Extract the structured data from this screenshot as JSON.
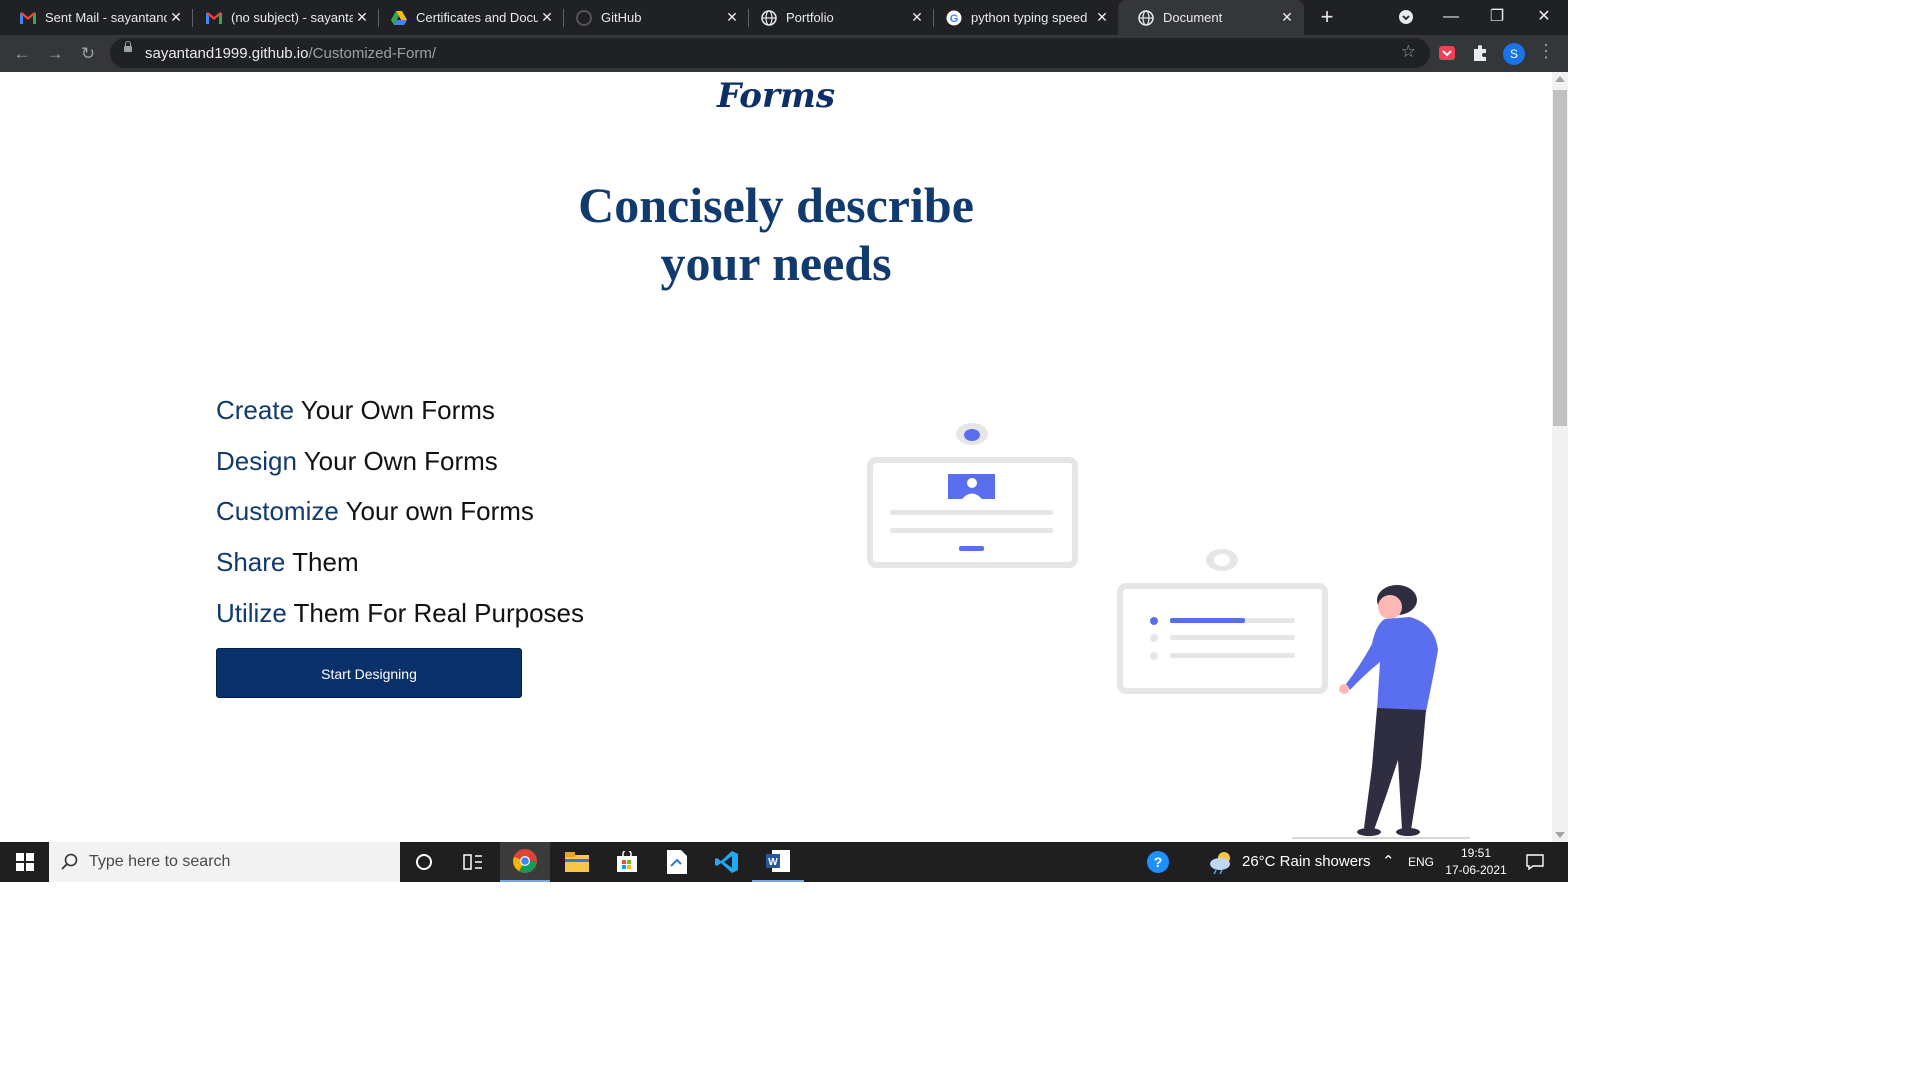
{
  "browser": {
    "tabs": [
      {
        "title": "Sent Mail - sayantand",
        "icon": "gmail-icon"
      },
      {
        "title": "(no subject) - sayanta",
        "icon": "gmail-icon"
      },
      {
        "title": "Certificates and Docu",
        "icon": "drive-icon"
      },
      {
        "title": "GitHub",
        "icon": "github-icon"
      },
      {
        "title": "Portfolio",
        "icon": "globe-icon"
      },
      {
        "title": "python typing speed",
        "icon": "google-icon"
      },
      {
        "title": "Document",
        "icon": "globe-icon"
      }
    ],
    "active_tab_index": 6,
    "url_host": "sayantand1999.github.io",
    "url_path": "/Customized-Form/",
    "profile_initial": "S"
  },
  "page": {
    "logo": "Forms",
    "headline_line1": "Concisely describe",
    "headline_line2": "your needs",
    "features": [
      {
        "highlight": "Create",
        "rest": " Your Own Forms"
      },
      {
        "highlight": "Design",
        "rest": " Your Own Forms"
      },
      {
        "highlight": "Customize",
        "rest": " Your own Forms"
      },
      {
        "highlight": "Share",
        "rest": " Them"
      },
      {
        "highlight": "Utilize",
        "rest": " Them For Real Purposes"
      }
    ],
    "cta_label": "Start Designing",
    "colors": {
      "primary": "#0a3069",
      "accent": "#5a6ff0",
      "heading": "#113a6e"
    }
  },
  "taskbar": {
    "search_placeholder": "Type here to search",
    "weather": "26°C  Rain showers",
    "lang": "ENG",
    "time": "19:51",
    "date": "17-06-2021"
  }
}
